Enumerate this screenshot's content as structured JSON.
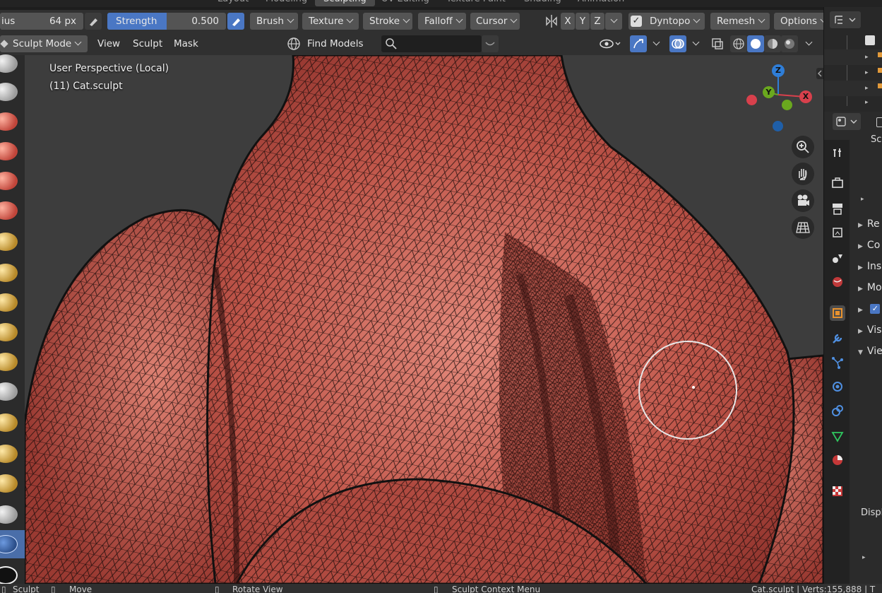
{
  "workspace_tabs": [
    "Layout",
    "Modeling",
    "Sculpting",
    "UV Editing",
    "Texture Paint",
    "Shading",
    "Animation"
  ],
  "active_workspace": "Sculpting",
  "toolbar": {
    "radius_label": "ius",
    "radius_value": "64 px",
    "strength_label": "Strength",
    "strength_value": "0.500",
    "strength_fraction": 0.5,
    "brush": "Brush",
    "texture": "Texture",
    "stroke": "Stroke",
    "falloff": "Falloff",
    "cursor": "Cursor",
    "axis_x": "X",
    "axis_y": "Y",
    "axis_z": "Z",
    "dyntopo": "Dyntopo",
    "remesh": "Remesh",
    "options": "Options"
  },
  "header": {
    "mode": "Sculpt Mode",
    "menu_view": "View",
    "menu_sculpt": "Sculpt",
    "menu_mask": "Mask",
    "find_models": "Find Models",
    "search_value": ""
  },
  "viewport": {
    "perspective": "User Perspective (Local)",
    "object": "(11) Cat.sculpt",
    "gizmo": {
      "z": "Z",
      "y": "Y",
      "x": "X"
    }
  },
  "properties": {
    "panels": [
      "Re",
      "Co",
      "Ins",
      "Mo",
      "",
      "Vis",
      "Vie"
    ],
    "footer_label": "Displ",
    "top_label": "Sc"
  },
  "statusbar": {
    "sculpt": "Sculpt",
    "move": "Move",
    "rotate": "Rotate View",
    "context": "Sculpt Context Menu",
    "stats": "Cat.sculpt | Verts:155,888 | T"
  },
  "colors": {
    "accent": "#4a77c4",
    "mesh_base": "#c0564a",
    "mesh_light": "#e48a7c",
    "viewport_bg": "#3d3d3d"
  }
}
